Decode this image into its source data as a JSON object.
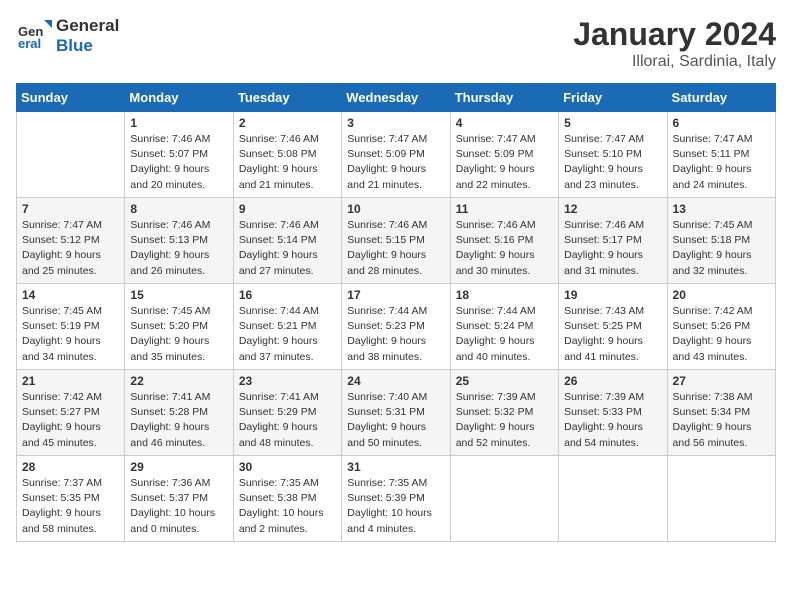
{
  "header": {
    "logo_general": "General",
    "logo_blue": "Blue",
    "title": "January 2024",
    "location": "Illorai, Sardinia, Italy"
  },
  "days_of_week": [
    "Sunday",
    "Monday",
    "Tuesday",
    "Wednesday",
    "Thursday",
    "Friday",
    "Saturday"
  ],
  "weeks": [
    [
      {
        "day": "",
        "sunrise": "",
        "sunset": "",
        "daylight": ""
      },
      {
        "day": "1",
        "sunrise": "Sunrise: 7:46 AM",
        "sunset": "Sunset: 5:07 PM",
        "daylight": "Daylight: 9 hours and 20 minutes."
      },
      {
        "day": "2",
        "sunrise": "Sunrise: 7:46 AM",
        "sunset": "Sunset: 5:08 PM",
        "daylight": "Daylight: 9 hours and 21 minutes."
      },
      {
        "day": "3",
        "sunrise": "Sunrise: 7:47 AM",
        "sunset": "Sunset: 5:09 PM",
        "daylight": "Daylight: 9 hours and 21 minutes."
      },
      {
        "day": "4",
        "sunrise": "Sunrise: 7:47 AM",
        "sunset": "Sunset: 5:09 PM",
        "daylight": "Daylight: 9 hours and 22 minutes."
      },
      {
        "day": "5",
        "sunrise": "Sunrise: 7:47 AM",
        "sunset": "Sunset: 5:10 PM",
        "daylight": "Daylight: 9 hours and 23 minutes."
      },
      {
        "day": "6",
        "sunrise": "Sunrise: 7:47 AM",
        "sunset": "Sunset: 5:11 PM",
        "daylight": "Daylight: 9 hours and 24 minutes."
      }
    ],
    [
      {
        "day": "7",
        "sunrise": "Sunrise: 7:47 AM",
        "sunset": "Sunset: 5:12 PM",
        "daylight": "Daylight: 9 hours and 25 minutes."
      },
      {
        "day": "8",
        "sunrise": "Sunrise: 7:46 AM",
        "sunset": "Sunset: 5:13 PM",
        "daylight": "Daylight: 9 hours and 26 minutes."
      },
      {
        "day": "9",
        "sunrise": "Sunrise: 7:46 AM",
        "sunset": "Sunset: 5:14 PM",
        "daylight": "Daylight: 9 hours and 27 minutes."
      },
      {
        "day": "10",
        "sunrise": "Sunrise: 7:46 AM",
        "sunset": "Sunset: 5:15 PM",
        "daylight": "Daylight: 9 hours and 28 minutes."
      },
      {
        "day": "11",
        "sunrise": "Sunrise: 7:46 AM",
        "sunset": "Sunset: 5:16 PM",
        "daylight": "Daylight: 9 hours and 30 minutes."
      },
      {
        "day": "12",
        "sunrise": "Sunrise: 7:46 AM",
        "sunset": "Sunset: 5:17 PM",
        "daylight": "Daylight: 9 hours and 31 minutes."
      },
      {
        "day": "13",
        "sunrise": "Sunrise: 7:45 AM",
        "sunset": "Sunset: 5:18 PM",
        "daylight": "Daylight: 9 hours and 32 minutes."
      }
    ],
    [
      {
        "day": "14",
        "sunrise": "Sunrise: 7:45 AM",
        "sunset": "Sunset: 5:19 PM",
        "daylight": "Daylight: 9 hours and 34 minutes."
      },
      {
        "day": "15",
        "sunrise": "Sunrise: 7:45 AM",
        "sunset": "Sunset: 5:20 PM",
        "daylight": "Daylight: 9 hours and 35 minutes."
      },
      {
        "day": "16",
        "sunrise": "Sunrise: 7:44 AM",
        "sunset": "Sunset: 5:21 PM",
        "daylight": "Daylight: 9 hours and 37 minutes."
      },
      {
        "day": "17",
        "sunrise": "Sunrise: 7:44 AM",
        "sunset": "Sunset: 5:23 PM",
        "daylight": "Daylight: 9 hours and 38 minutes."
      },
      {
        "day": "18",
        "sunrise": "Sunrise: 7:44 AM",
        "sunset": "Sunset: 5:24 PM",
        "daylight": "Daylight: 9 hours and 40 minutes."
      },
      {
        "day": "19",
        "sunrise": "Sunrise: 7:43 AM",
        "sunset": "Sunset: 5:25 PM",
        "daylight": "Daylight: 9 hours and 41 minutes."
      },
      {
        "day": "20",
        "sunrise": "Sunrise: 7:42 AM",
        "sunset": "Sunset: 5:26 PM",
        "daylight": "Daylight: 9 hours and 43 minutes."
      }
    ],
    [
      {
        "day": "21",
        "sunrise": "Sunrise: 7:42 AM",
        "sunset": "Sunset: 5:27 PM",
        "daylight": "Daylight: 9 hours and 45 minutes."
      },
      {
        "day": "22",
        "sunrise": "Sunrise: 7:41 AM",
        "sunset": "Sunset: 5:28 PM",
        "daylight": "Daylight: 9 hours and 46 minutes."
      },
      {
        "day": "23",
        "sunrise": "Sunrise: 7:41 AM",
        "sunset": "Sunset: 5:29 PM",
        "daylight": "Daylight: 9 hours and 48 minutes."
      },
      {
        "day": "24",
        "sunrise": "Sunrise: 7:40 AM",
        "sunset": "Sunset: 5:31 PM",
        "daylight": "Daylight: 9 hours and 50 minutes."
      },
      {
        "day": "25",
        "sunrise": "Sunrise: 7:39 AM",
        "sunset": "Sunset: 5:32 PM",
        "daylight": "Daylight: 9 hours and 52 minutes."
      },
      {
        "day": "26",
        "sunrise": "Sunrise: 7:39 AM",
        "sunset": "Sunset: 5:33 PM",
        "daylight": "Daylight: 9 hours and 54 minutes."
      },
      {
        "day": "27",
        "sunrise": "Sunrise: 7:38 AM",
        "sunset": "Sunset: 5:34 PM",
        "daylight": "Daylight: 9 hours and 56 minutes."
      }
    ],
    [
      {
        "day": "28",
        "sunrise": "Sunrise: 7:37 AM",
        "sunset": "Sunset: 5:35 PM",
        "daylight": "Daylight: 9 hours and 58 minutes."
      },
      {
        "day": "29",
        "sunrise": "Sunrise: 7:36 AM",
        "sunset": "Sunset: 5:37 PM",
        "daylight": "Daylight: 10 hours and 0 minutes."
      },
      {
        "day": "30",
        "sunrise": "Sunrise: 7:35 AM",
        "sunset": "Sunset: 5:38 PM",
        "daylight": "Daylight: 10 hours and 2 minutes."
      },
      {
        "day": "31",
        "sunrise": "Sunrise: 7:35 AM",
        "sunset": "Sunset: 5:39 PM",
        "daylight": "Daylight: 10 hours and 4 minutes."
      },
      {
        "day": "",
        "sunrise": "",
        "sunset": "",
        "daylight": ""
      },
      {
        "day": "",
        "sunrise": "",
        "sunset": "",
        "daylight": ""
      },
      {
        "day": "",
        "sunrise": "",
        "sunset": "",
        "daylight": ""
      }
    ]
  ]
}
